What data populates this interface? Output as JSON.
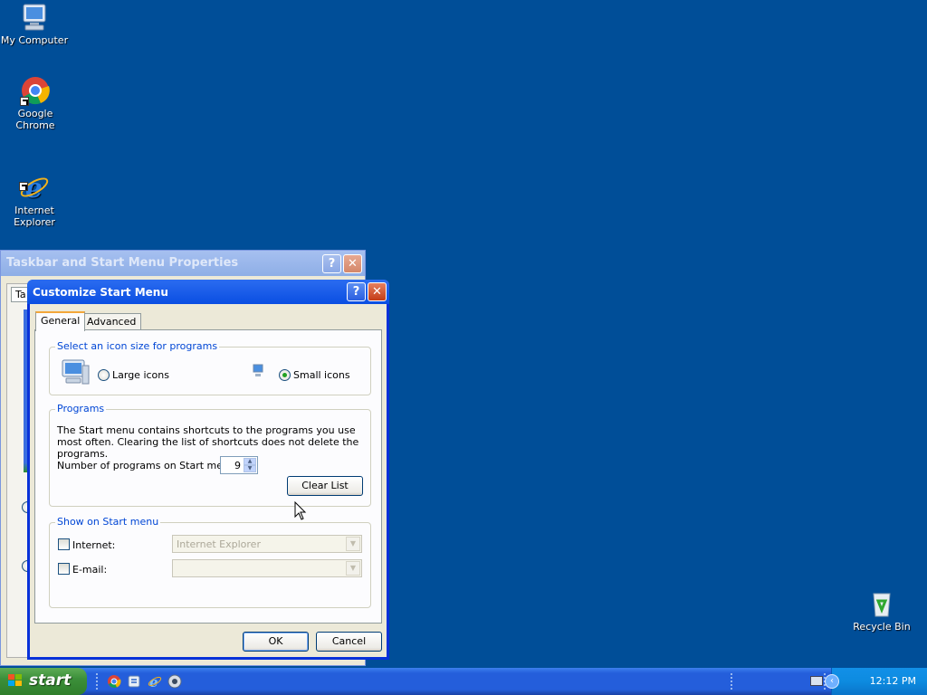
{
  "desktop": {
    "icons": [
      {
        "label": "My Computer",
        "icon": "my-computer-icon"
      },
      {
        "label": "Google Chrome",
        "icon": "chrome-icon"
      },
      {
        "label": "Internet\nExplorer",
        "icon": "internet-explorer-icon"
      },
      {
        "label": "Recycle Bin",
        "icon": "recycle-bin-icon"
      }
    ]
  },
  "back_window": {
    "title": "Taskbar and Start Menu Properties",
    "tab_partial": "Ta",
    "help_label": "?",
    "close_label": "✕"
  },
  "dialog": {
    "title": "Customize Start Menu",
    "help_label": "?",
    "close_label": "✕",
    "tabs": [
      {
        "label": "General",
        "active": true
      },
      {
        "label": "Advanced",
        "active": false
      }
    ],
    "icon_size": {
      "group_label": "Select an icon size for programs",
      "large_label": "Large icons",
      "small_label": "Small icons",
      "selected": "small"
    },
    "programs": {
      "group_label": "Programs",
      "description": "The Start menu contains shortcuts to the programs you use most often. Clearing the list of shortcuts does not delete the programs.",
      "count_label": "Number of programs on Start menu:",
      "count_value": "9",
      "clear_label": "Clear List"
    },
    "show_on_start": {
      "group_label": "Show on Start menu",
      "internet_label": "Internet:",
      "internet_value": "Internet Explorer",
      "internet_checked": false,
      "email_label": "E-mail:",
      "email_value": "",
      "email_checked": false
    },
    "ok_label": "OK",
    "cancel_label": "Cancel"
  },
  "taskbar": {
    "start_label": "start",
    "quick_launch": [
      "chrome-icon",
      "explorer-icon",
      "internet-explorer-icon",
      "media-icon"
    ],
    "clock": "12:12 PM"
  }
}
